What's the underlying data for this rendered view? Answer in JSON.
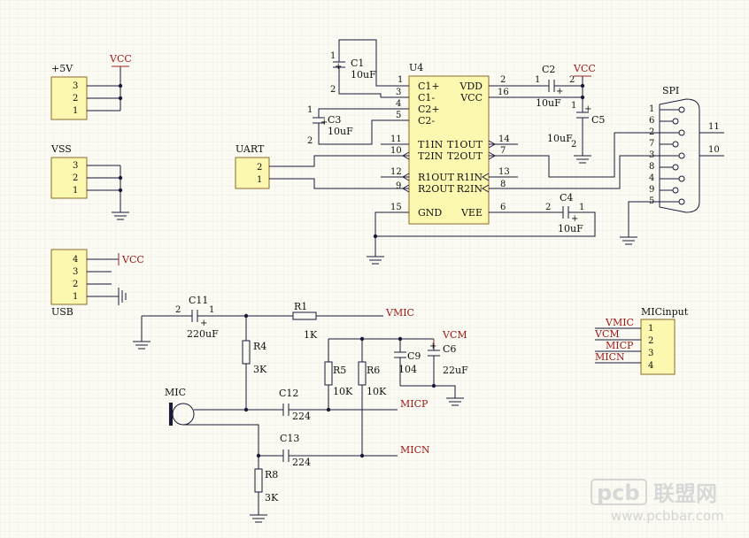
{
  "connectors": {
    "p5v": {
      "title": "+5V",
      "pins": [
        "3",
        "2",
        "1"
      ],
      "net": "VCC"
    },
    "vss": {
      "title": "VSS",
      "pins": [
        "3",
        "2",
        "1"
      ]
    },
    "usb": {
      "title": "USB",
      "pins": [
        "4",
        "3",
        "2",
        "1"
      ],
      "net": "VCC"
    },
    "uart": {
      "title": "UART",
      "pins": [
        "2",
        "1"
      ]
    },
    "spi": {
      "title": "SPI",
      "pins": [
        "1",
        "6",
        "2",
        "7",
        "3",
        "8",
        "4",
        "9",
        "5"
      ],
      "out_a": "11",
      "out_b": "10"
    },
    "micinput": {
      "title": "MICinput",
      "pins": [
        "1",
        "2",
        "3",
        "4"
      ],
      "nets": [
        "VMIC",
        "VCM",
        "MICP",
        "MICN"
      ]
    }
  },
  "u4": {
    "ref": "U4",
    "left_pins": [
      {
        "num": "1",
        "name": "C1+"
      },
      {
        "num": "3",
        "name": "C1-"
      },
      {
        "num": "4",
        "name": "C2+"
      },
      {
        "num": "5",
        "name": "C2-"
      },
      {
        "num": "11",
        "name": "T1IN"
      },
      {
        "num": "10",
        "name": "T2IN"
      },
      {
        "num": "12",
        "name": "R1OUT"
      },
      {
        "num": "9",
        "name": "R2OUT"
      },
      {
        "num": "15",
        "name": "GND"
      }
    ],
    "right_pins": [
      {
        "num": "2",
        "name": "VDD"
      },
      {
        "num": "16",
        "name": "VCC"
      },
      {
        "num": "14",
        "name": "T1OUT"
      },
      {
        "num": "7",
        "name": "T2OUT"
      },
      {
        "num": "13",
        "name": "R1IN"
      },
      {
        "num": "8",
        "name": "R2IN"
      },
      {
        "num": "6",
        "name": "VEE"
      }
    ]
  },
  "caps": {
    "c1": {
      "ref": "C1",
      "value": "10uF",
      "pa": "1",
      "pb": "2"
    },
    "c2": {
      "ref": "C2",
      "value": "10uF",
      "pa": "1",
      "pb": "2"
    },
    "c3": {
      "ref": "C3",
      "value": "10uF",
      "pa": "1",
      "pb": "2"
    },
    "c4": {
      "ref": "C4",
      "value": "10uF",
      "pa": "2",
      "pb": "1"
    },
    "c5": {
      "ref": "C5",
      "value": "10uF",
      "pa": "1",
      "pb": "2"
    },
    "c6": {
      "ref": "C6",
      "value": "22uF"
    },
    "c9": {
      "ref": "C9",
      "value": "104"
    },
    "c11": {
      "ref": "C11",
      "value": "220uF",
      "pa": "2",
      "pb": "1"
    },
    "c12": {
      "ref": "C12",
      "value": "224"
    },
    "c13": {
      "ref": "C13",
      "value": "224"
    }
  },
  "res": {
    "r1": {
      "ref": "R1",
      "value": "1K"
    },
    "r4": {
      "ref": "R4",
      "value": "3K"
    },
    "r5": {
      "ref": "R5",
      "value": "10K"
    },
    "r6": {
      "ref": "R6",
      "value": "10K"
    },
    "r8": {
      "ref": "R8",
      "value": "3K"
    }
  },
  "nets": {
    "vcc": "VCC",
    "vmic": "VMIC",
    "vcm": "VCM",
    "micp": "MICP",
    "micn": "MICN"
  },
  "mic": {
    "ref": "MIC"
  },
  "watermark": {
    "logo": "pcb",
    "cn": "联盟网",
    "url": "www.pcbbar.com"
  },
  "colors": {
    "wire": "#1a1a3a",
    "power": "#a01818",
    "part_fill": "#fdf8b0",
    "part_border": "#8a6a2a",
    "background": "#fbfbf3",
    "grid": "#e2e2da"
  }
}
